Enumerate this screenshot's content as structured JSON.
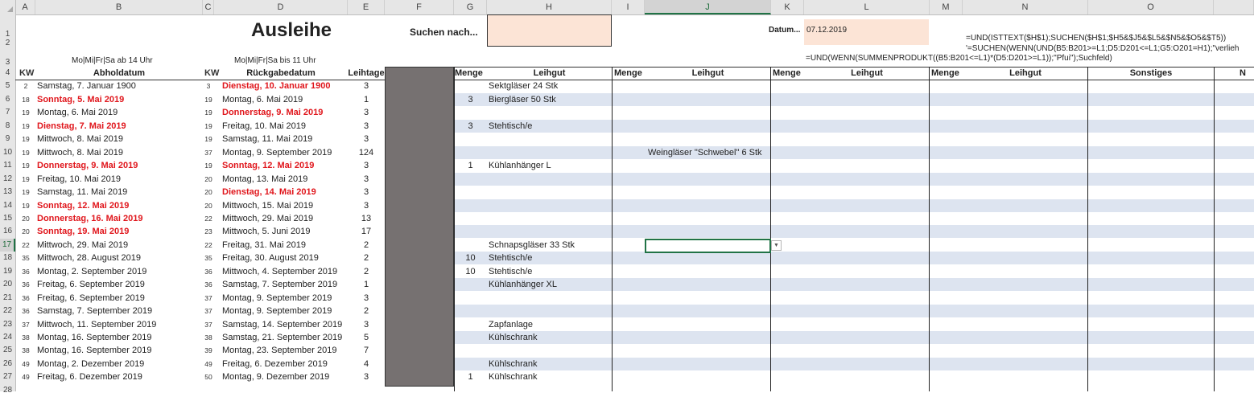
{
  "columns": [
    "A",
    "B",
    "C",
    "D",
    "E",
    "F",
    "G",
    "H",
    "I",
    "J",
    "K",
    "L",
    "M",
    "N",
    "O"
  ],
  "selected_column": "J",
  "selected_row": 17,
  "row_numbers": [
    "1",
    "2",
    "3",
    "4",
    "5",
    "6",
    "7",
    "8",
    "9",
    "10",
    "11",
    "12",
    "13",
    "14",
    "15",
    "16",
    "17",
    "18",
    "19",
    "20",
    "21",
    "22",
    "23",
    "24",
    "25",
    "26",
    "27",
    "28"
  ],
  "title": "Ausleihe",
  "search_label": "Suchen nach...",
  "search_value": "",
  "date_label": "Datum...",
  "date_value": "07.12.2019",
  "note_pickup": "Mo|Mi|Fr|Sa ab 14 Uhr",
  "note_return": "Mo|Mi|Fr|Sa bis 11 Uhr",
  "formula_1": "=UND(ISTTEXT($H$1);SUCHEN($H$1;$H5&$J5&$L5&$N5&$O5&$T5))",
  "formula_2": "'=SUCHEN(WENN(UND(B5:B201>=L1;D5:D201<=L1;G5:O201=H1);\"verlieh",
  "formula_3": "=UND(WENN(SUMMENPRODUKT((B5:B201<=L1)*(D5:D201>=L1));\"Pfui\");Suchfeld)",
  "headers": {
    "kw1": "KW",
    "abholdatum": "Abholdatum",
    "kw2": "KW",
    "rueckgabedatum": "Rückgabedatum",
    "leihtage": "Leihtage",
    "menge1": "Menge",
    "leihgut1": "Leihgut",
    "menge2": "Menge",
    "leihgut2": "Leihgut",
    "menge3": "Menge",
    "leihgut3": "Leihgut",
    "menge4": "Menge",
    "leihgut4": "Leihgut",
    "sonstiges": "Sonstiges",
    "p_cut": "N"
  },
  "rows": [
    {
      "kw1": "2",
      "ab": "Samstag, 7. Januar 1900",
      "ab_red": false,
      "kw2": "3",
      "rg": "Dienstag, 10. Januar 1900",
      "rg_red": true,
      "days": "3",
      "m1": "",
      "g1": "Sektgläser 24 Stk",
      "g2": ""
    },
    {
      "kw1": "18",
      "ab": "Sonntag, 5. Mai 2019",
      "ab_red": true,
      "kw2": "19",
      "rg": "Montag, 6. Mai 2019",
      "rg_red": false,
      "days": "1",
      "m1": "3",
      "g1": "Biergläser 50 Stk",
      "g2": ""
    },
    {
      "kw1": "19",
      "ab": "Montag, 6. Mai 2019",
      "ab_red": false,
      "kw2": "19",
      "rg": "Donnerstag, 9. Mai 2019",
      "rg_red": true,
      "days": "3",
      "m1": "",
      "g1": "",
      "g2": ""
    },
    {
      "kw1": "19",
      "ab": "Dienstag, 7. Mai 2019",
      "ab_red": true,
      "kw2": "19",
      "rg": "Freitag, 10. Mai 2019",
      "rg_red": false,
      "days": "3",
      "m1": "3",
      "g1": "Stehtisch/e",
      "g2": ""
    },
    {
      "kw1": "19",
      "ab": "Mittwoch, 8. Mai 2019",
      "ab_red": false,
      "kw2": "19",
      "rg": "Samstag, 11. Mai 2019",
      "rg_red": false,
      "days": "3",
      "m1": "",
      "g1": "",
      "g2": ""
    },
    {
      "kw1": "19",
      "ab": "Mittwoch, 8. Mai 2019",
      "ab_red": false,
      "kw2": "37",
      "rg": "Montag, 9. September 2019",
      "rg_red": false,
      "days": "124",
      "m1": "",
      "g1": "",
      "g2": "Weingläser \"Schwebel\" 6 Stk"
    },
    {
      "kw1": "19",
      "ab": "Donnerstag, 9. Mai 2019",
      "ab_red": true,
      "kw2": "19",
      "rg": "Sonntag, 12. Mai 2019",
      "rg_red": true,
      "days": "3",
      "m1": "1",
      "g1": "Kühlanhänger L",
      "g2": ""
    },
    {
      "kw1": "19",
      "ab": "Freitag, 10. Mai 2019",
      "ab_red": false,
      "kw2": "20",
      "rg": "Montag, 13. Mai 2019",
      "rg_red": false,
      "days": "3",
      "m1": "",
      "g1": "",
      "g2": ""
    },
    {
      "kw1": "19",
      "ab": "Samstag, 11. Mai 2019",
      "ab_red": false,
      "kw2": "20",
      "rg": "Dienstag, 14. Mai 2019",
      "rg_red": true,
      "days": "3",
      "m1": "",
      "g1": "",
      "g2": ""
    },
    {
      "kw1": "19",
      "ab": "Sonntag, 12. Mai 2019",
      "ab_red": true,
      "kw2": "20",
      "rg": "Mittwoch, 15. Mai 2019",
      "rg_red": false,
      "days": "3",
      "m1": "",
      "g1": "",
      "g2": ""
    },
    {
      "kw1": "20",
      "ab": "Donnerstag, 16. Mai 2019",
      "ab_red": true,
      "kw2": "22",
      "rg": "Mittwoch, 29. Mai 2019",
      "rg_red": false,
      "days": "13",
      "m1": "",
      "g1": "",
      "g2": ""
    },
    {
      "kw1": "20",
      "ab": "Sonntag, 19. Mai 2019",
      "ab_red": true,
      "kw2": "23",
      "rg": "Mittwoch, 5. Juni 2019",
      "rg_red": false,
      "days": "17",
      "m1": "",
      "g1": "",
      "g2": ""
    },
    {
      "kw1": "22",
      "ab": "Mittwoch, 29. Mai 2019",
      "ab_red": false,
      "kw2": "22",
      "rg": "Freitag, 31. Mai 2019",
      "rg_red": false,
      "days": "2",
      "m1": "",
      "g1": "Schnapsgläser 33 Stk",
      "g2": ""
    },
    {
      "kw1": "35",
      "ab": "Mittwoch, 28. August 2019",
      "ab_red": false,
      "kw2": "35",
      "rg": "Freitag, 30. August 2019",
      "rg_red": false,
      "days": "2",
      "m1": "10",
      "g1": "Stehtisch/e",
      "g2": ""
    },
    {
      "kw1": "36",
      "ab": "Montag, 2. September 2019",
      "ab_red": false,
      "kw2": "36",
      "rg": "Mittwoch, 4. September 2019",
      "rg_red": false,
      "days": "2",
      "m1": "10",
      "g1": "Stehtisch/e",
      "g2": ""
    },
    {
      "kw1": "36",
      "ab": "Freitag, 6. September 2019",
      "ab_red": false,
      "kw2": "36",
      "rg": "Samstag, 7. September 2019",
      "rg_red": false,
      "days": "1",
      "m1": "",
      "g1": "Kühlanhänger XL",
      "g2": ""
    },
    {
      "kw1": "36",
      "ab": "Freitag, 6. September 2019",
      "ab_red": false,
      "kw2": "37",
      "rg": "Montag, 9. September 2019",
      "rg_red": false,
      "days": "3",
      "m1": "",
      "g1": "",
      "g2": ""
    },
    {
      "kw1": "36",
      "ab": "Samstag, 7. September 2019",
      "ab_red": false,
      "kw2": "37",
      "rg": "Montag, 9. September 2019",
      "rg_red": false,
      "days": "2",
      "m1": "",
      "g1": "",
      "g2": ""
    },
    {
      "kw1": "37",
      "ab": "Mittwoch, 11. September 2019",
      "ab_red": false,
      "kw2": "37",
      "rg": "Samstag, 14. September 2019",
      "rg_red": false,
      "days": "3",
      "m1": "",
      "g1": "Zapfanlage",
      "g2": ""
    },
    {
      "kw1": "38",
      "ab": "Montag, 16. September 2019",
      "ab_red": false,
      "kw2": "38",
      "rg": "Samstag, 21. September 2019",
      "rg_red": false,
      "days": "5",
      "m1": "",
      "g1": "Kühlschrank",
      "g2": ""
    },
    {
      "kw1": "38",
      "ab": "Montag, 16. September 2019",
      "ab_red": false,
      "kw2": "39",
      "rg": "Montag, 23. September 2019",
      "rg_red": false,
      "days": "7",
      "m1": "",
      "g1": "",
      "g2": ""
    },
    {
      "kw1": "49",
      "ab": "Montag, 2. Dezember 2019",
      "ab_red": false,
      "kw2": "49",
      "rg": "Freitag, 6. Dezember 2019",
      "rg_red": false,
      "days": "4",
      "m1": "",
      "g1": "Kühlschrank",
      "g2": ""
    },
    {
      "kw1": "49",
      "ab": "Freitag, 6. Dezember 2019",
      "ab_red": false,
      "kw2": "50",
      "rg": "Montag, 9. Dezember 2019",
      "rg_red": false,
      "days": "3",
      "m1": "1",
      "g1": "Kühlschrank",
      "g2": ""
    }
  ],
  "colors": {
    "accent": "#217346",
    "band": "#dde4f0",
    "peach": "#fce4d6",
    "gray_block": "#767171",
    "red_text": "#e0161c"
  },
  "icons": {
    "corner": "select-all-triangle-icon",
    "dropdown": "dropdown-arrow-icon"
  }
}
